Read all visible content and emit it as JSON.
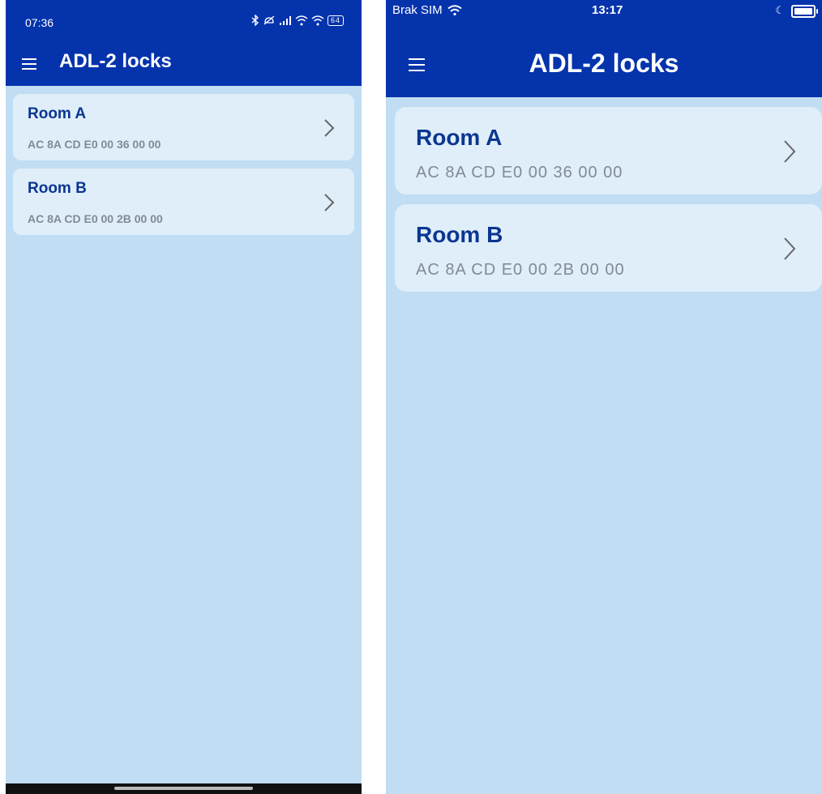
{
  "android": {
    "status_time": "07:36",
    "status_icons": [
      "bluetooth-icon",
      "mute-icon",
      "signal-icon",
      "wifi-icon",
      "battery-icon"
    ],
    "battery": "64",
    "title": "ADL-2 locks",
    "locks": [
      {
        "name": "Room A",
        "mac": "AC 8A CD E0 00 36 00 00"
      },
      {
        "name": "Room B",
        "mac": "AC 8A CD E0 00 2B 00 00"
      }
    ]
  },
  "ios": {
    "carrier": "Brak SIM",
    "status_time": "13:17",
    "title": "ADL-2 locks",
    "locks": [
      {
        "name": "Room A",
        "mac": "AC 8A CD E0 00 36 00 00"
      },
      {
        "name": "Room B",
        "mac": "AC 8A CD E0 00 2B 00 00"
      }
    ]
  },
  "colors": {
    "appbar": "#0433ac",
    "background": "#c0ddf3",
    "card": "#dfeef9",
    "card_title": "#0b3690",
    "card_subtitle": "#808b96"
  }
}
